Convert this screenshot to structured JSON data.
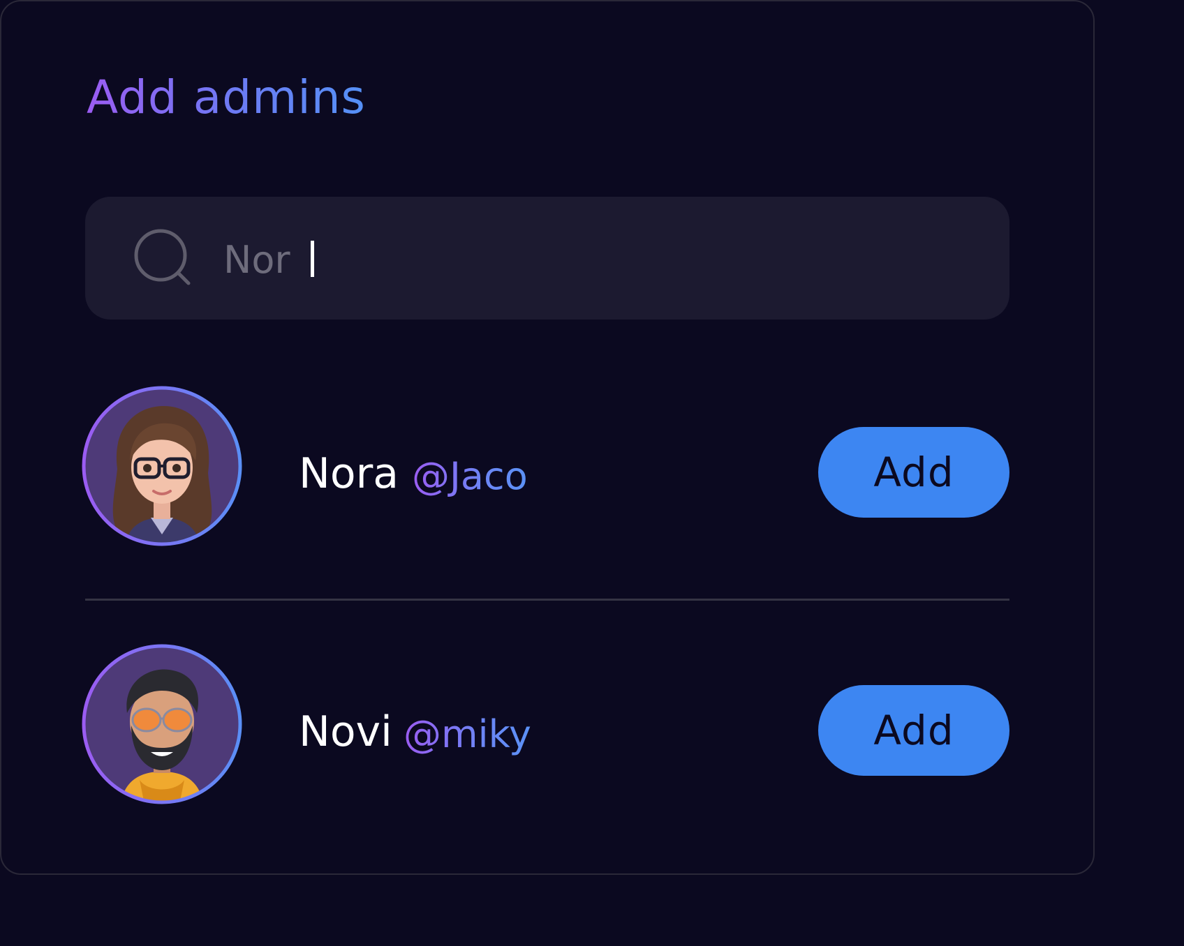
{
  "panel": {
    "title": "Add admins"
  },
  "search": {
    "value": "Nor ",
    "icon": "search-icon"
  },
  "users": [
    {
      "name": "Nora",
      "handle": "@Jaco",
      "add_label": "Add",
      "avatar": "avatar-woman-glasses"
    },
    {
      "name": "Novi",
      "handle": "@miky",
      "add_label": "Add",
      "avatar": "avatar-man-beard-sunglasses"
    }
  ],
  "colors": {
    "background": "#0b0920",
    "search_background": "#1c1a30",
    "button": "#3d86f2",
    "gradient_start": "#9b5cf2",
    "gradient_end": "#5591f6"
  }
}
